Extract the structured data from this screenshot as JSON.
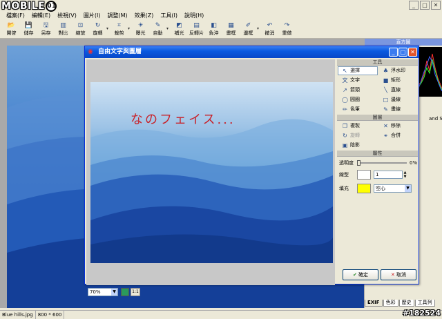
{
  "app": {
    "logo_text": "MOBILE",
    "logo_o": "01",
    "menu": [
      "檔案(F)",
      "編輯(E)",
      "檢視(V)",
      "圖片(I)",
      "調整(M)",
      "效果(Z)",
      "工具(I)",
      "說明(H)"
    ],
    "toolbar": [
      {
        "icon": "open-icon",
        "glyph": "📂",
        "label": "開啓"
      },
      {
        "icon": "save-icon",
        "glyph": "💾",
        "label": "儲存"
      },
      {
        "icon": "save-as-icon",
        "glyph": "🖫",
        "label": "另存"
      },
      {
        "icon": "compare-icon",
        "glyph": "▥",
        "label": "對比"
      },
      {
        "icon": "resize-icon",
        "glyph": "⊡",
        "label": "縮放"
      },
      {
        "icon": "rotate-icon",
        "glyph": "↻",
        "label": "旋轉"
      },
      {
        "icon": "crop-icon",
        "glyph": "⌗",
        "label": "裁剪"
      },
      {
        "icon": "exposure-icon",
        "glyph": "☀",
        "label": "曝光"
      },
      {
        "icon": "auto-icon",
        "glyph": "✎",
        "label": "自動"
      },
      {
        "icon": "fill-light-icon",
        "glyph": "◩",
        "label": "補光"
      },
      {
        "icon": "negative-icon",
        "glyph": "▤",
        "label": "反轉片"
      },
      {
        "icon": "wash-icon",
        "glyph": "◧",
        "label": "負沖"
      },
      {
        "icon": "collage-icon",
        "glyph": "▦",
        "label": "畫框"
      },
      {
        "icon": "border-icon",
        "glyph": "✐",
        "label": "邊框"
      },
      {
        "icon": "undo-icon",
        "glyph": "↶",
        "label": "撤消"
      },
      {
        "icon": "redo-icon",
        "glyph": "↷",
        "label": "重做"
      }
    ],
    "right_panel_title": "直方圖",
    "right_panel_text": "and Setting",
    "right_tabs": [
      "EXIF",
      "色彩",
      "歷史",
      "工具列"
    ],
    "status": {
      "filename": "Blue hills.jpg",
      "dimensions": "800 * 600"
    },
    "watermark": "#182524"
  },
  "dialog": {
    "title": "自由文字與圖層",
    "preview_text": "なのフェイス...",
    "zoom_value": "70%",
    "one_to_one": "1:1",
    "tools_header": "工具",
    "tools": [
      {
        "icon": "cursor-icon",
        "glyph": "↖",
        "label": "選擇",
        "active": true
      },
      {
        "icon": "watermark-icon",
        "glyph": "♣",
        "label": "浮水印"
      },
      {
        "icon": "text-icon",
        "glyph": "文",
        "label": "文字"
      },
      {
        "icon": "rectangle-icon",
        "glyph": "■",
        "label": "矩形"
      },
      {
        "icon": "arrow-icon",
        "glyph": "↗",
        "label": "箭頭"
      },
      {
        "icon": "line-icon",
        "glyph": "╲",
        "label": "直線"
      },
      {
        "icon": "ellipse-icon",
        "glyph": "◯",
        "label": "圓圈"
      },
      {
        "icon": "border-icon",
        "glyph": "□",
        "label": "邊線"
      },
      {
        "icon": "brush-icon",
        "glyph": "✏",
        "label": "色筆"
      },
      {
        "icon": "pencil-icon",
        "glyph": "✎",
        "label": "畫線"
      }
    ],
    "layers_header": "圖層",
    "layers": [
      {
        "icon": "copy-icon",
        "glyph": "❐",
        "label": "複製",
        "disabled": false
      },
      {
        "icon": "delete-icon",
        "glyph": "✕",
        "label": "移除",
        "disabled": false
      },
      {
        "icon": "rotate-icon",
        "glyph": "↻",
        "label": "旋轉",
        "disabled": true
      },
      {
        "icon": "merge-icon",
        "glyph": "⚭",
        "label": "合併",
        "disabled": false
      },
      {
        "icon": "shadow-icon",
        "glyph": "▣",
        "label": "陰影",
        "disabled": false
      }
    ],
    "props_header": "屬性",
    "opacity_label": "透明度",
    "opacity_value": "0%",
    "line_label": "線型",
    "line_value": "1",
    "fill_label": "填充",
    "fill_value": "空心",
    "fill_color": "#ffff00",
    "ok_label": "確定",
    "cancel_label": "取消"
  }
}
